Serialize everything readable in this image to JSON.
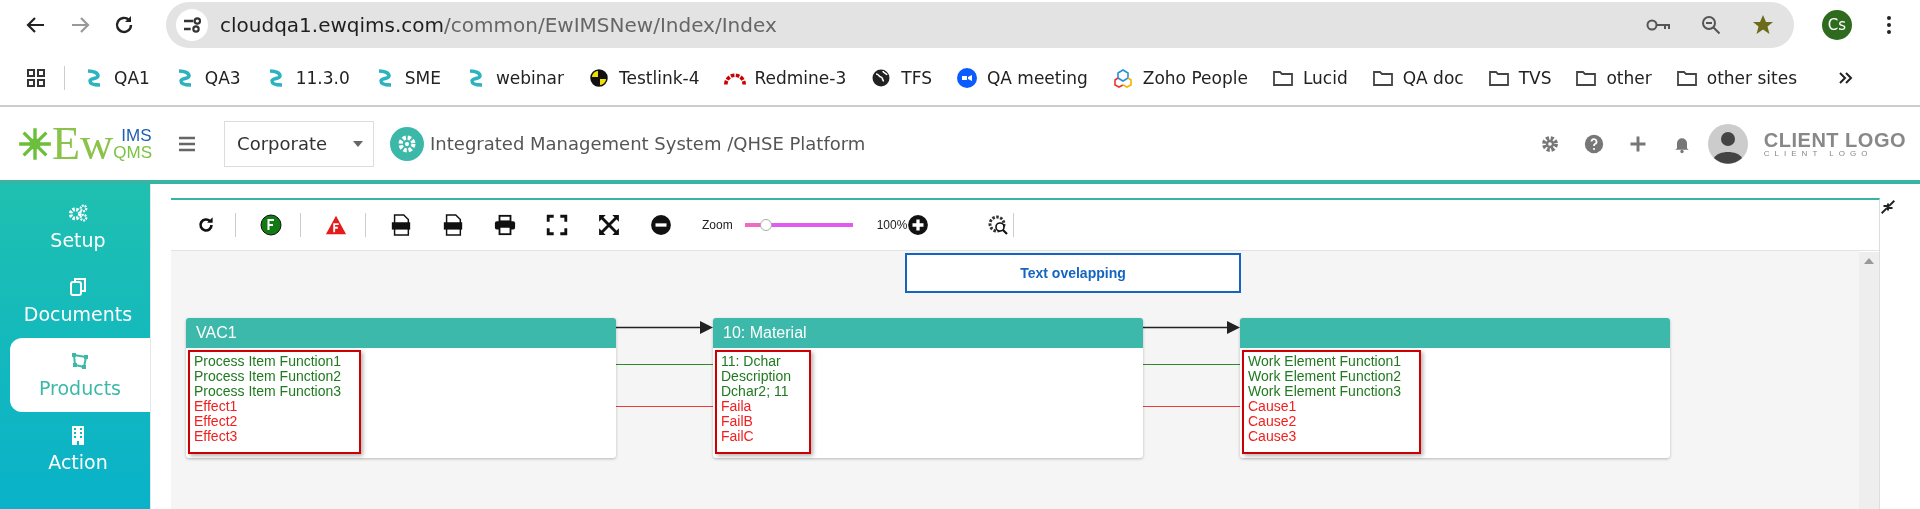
{
  "browser": {
    "url": {
      "domain": "cloudqa1.ewqims.com",
      "path": "/common/EwIMSNew/Index/Index"
    },
    "profile": "Cs",
    "bookmarks": [
      {
        "kind": "ewqims",
        "label": "QA1"
      },
      {
        "kind": "ewqims",
        "label": "QA3"
      },
      {
        "kind": "ewqims",
        "label": "11.3.0"
      },
      {
        "kind": "ewqims",
        "label": "SME"
      },
      {
        "kind": "ewqims",
        "label": "webinar"
      },
      {
        "kind": "testlink",
        "label": "Testlink-4"
      },
      {
        "kind": "redmine",
        "label": "Redmine-3"
      },
      {
        "kind": "globe",
        "label": "TFS"
      },
      {
        "kind": "zoom",
        "label": "QA meeting"
      },
      {
        "kind": "zoho",
        "label": "Zoho People"
      },
      {
        "kind": "folder",
        "label": "Lucid"
      },
      {
        "kind": "folder",
        "label": "QA doc"
      },
      {
        "kind": "folder",
        "label": "TVS"
      },
      {
        "kind": "folder",
        "label": "other"
      },
      {
        "kind": "folder",
        "label": "other sites"
      }
    ]
  },
  "header": {
    "logo": {
      "main": "Ew",
      "top": "IMS",
      "bottom": "QMS"
    },
    "organization": "Corporate",
    "title": "Integrated Management System /QHSE Platform",
    "client_logo": {
      "main": "CLIENT LOGO",
      "sub": "CLIENT LOGO"
    }
  },
  "sidebar": {
    "items": [
      {
        "label": "Setup",
        "selected": false
      },
      {
        "label": "Documents",
        "selected": false
      },
      {
        "label": "Products",
        "selected": true
      },
      {
        "label": "Action",
        "selected": false
      }
    ]
  },
  "toolbar": {
    "zoom_label": "Zoom",
    "zoom": {
      "level": 0.2
    },
    "zoom_reading": "100%"
  },
  "diagram": {
    "note": "Text ovelapping",
    "nodes": [
      {
        "title": "VAC1",
        "highlighted": true,
        "functions": [
          "Process Item Function1",
          "Process Item Function2",
          "Process Item Function3"
        ],
        "failures": [
          "Effect1",
          "Effect2",
          "Effect3"
        ]
      },
      {
        "title": "10: Material",
        "highlighted": true,
        "functions": [
          "11: Dchar",
          "Description",
          "Dchar2; 11"
        ],
        "failures": [
          "Faila",
          "FailB",
          "FailC"
        ]
      },
      {
        "highlighted": true,
        "functions": [
          "Work Element Function1",
          "Work Element Function2",
          "Work Element Function3"
        ],
        "failures": [
          "Cause1",
          "Cause2",
          "Cause3"
        ]
      }
    ]
  }
}
